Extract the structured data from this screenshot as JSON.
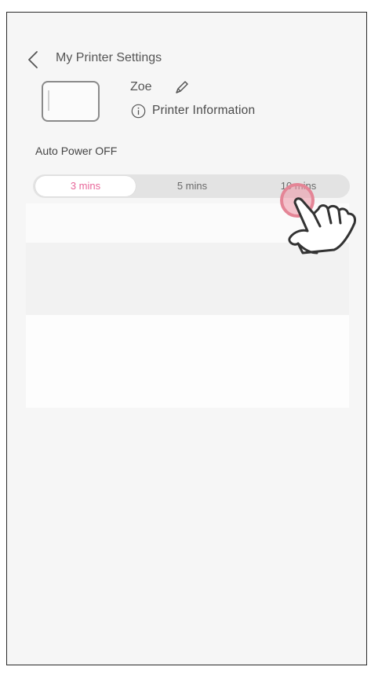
{
  "header": {
    "back_icon": "chevron-left-icon",
    "title": "My Printer Settings"
  },
  "printer": {
    "thumbnail_icon": "printer-icon",
    "name": "Zoe",
    "edit_icon": "pencil-icon",
    "info_icon": "info-circle-icon",
    "info_label": "Printer Information"
  },
  "auto_power_off": {
    "label": "Auto Power OFF",
    "options": [
      "3 mins",
      "5 mins",
      "10 mins"
    ],
    "selected": "3 mins",
    "selected_color": "#e8679a"
  },
  "overlay": {
    "hand_icon": "pointing-hand-icon",
    "tap_target": "10 mins",
    "tap_color": "#e48596"
  }
}
